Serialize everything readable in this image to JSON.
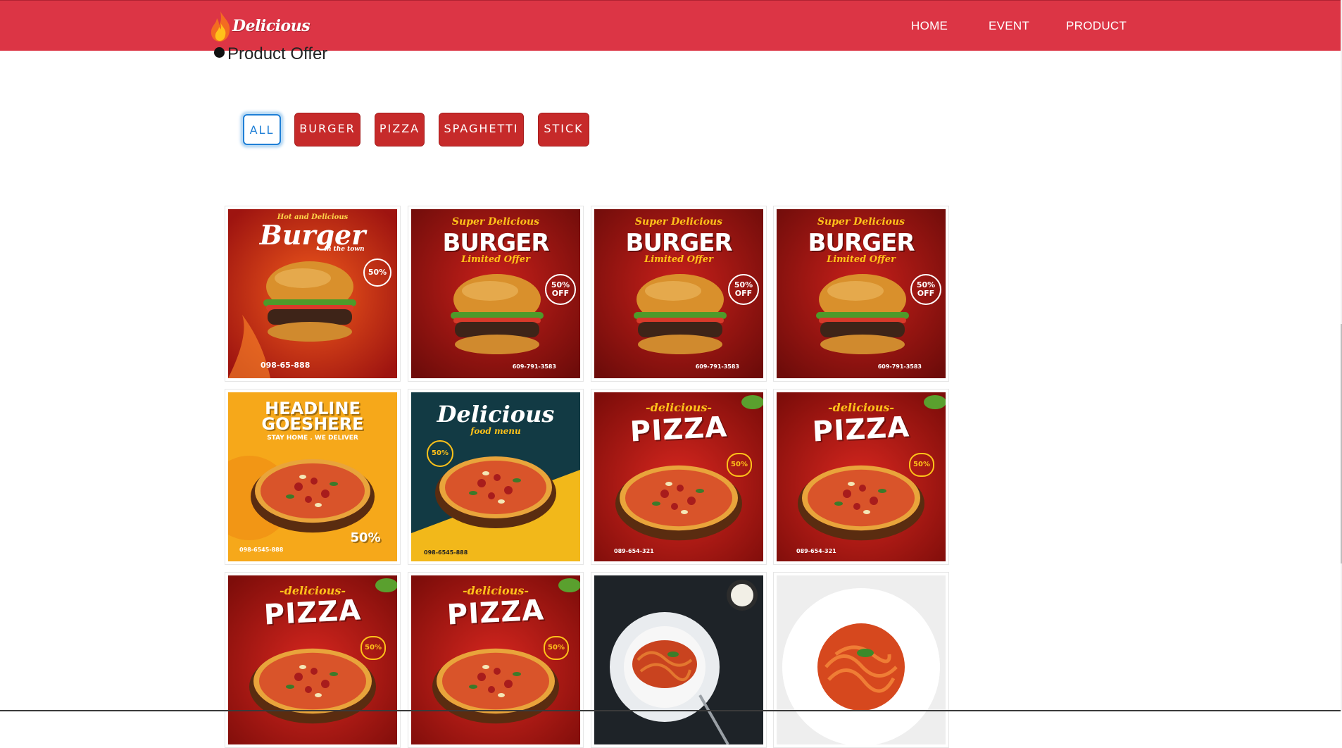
{
  "header": {
    "brand": "Delicious",
    "nav": [
      "HOME",
      "EVENT",
      "PRODUCT"
    ]
  },
  "section": {
    "title": "Product Offer"
  },
  "filters": [
    {
      "label": "ALL",
      "active": true
    },
    {
      "label": "BURGER",
      "active": false
    },
    {
      "label": "PIZZA",
      "active": false
    },
    {
      "label": "SPAGHETTI",
      "active": false
    },
    {
      "label": "STICK",
      "active": false
    }
  ],
  "products": [
    {
      "category": "burger",
      "style": "burger-a",
      "headline": "Burger",
      "kicker": "Hot and Delicious",
      "sub": "in the town",
      "badge": "50%",
      "phone": "098-65-888"
    },
    {
      "category": "burger",
      "style": "burger-b",
      "headline": "BURGER",
      "kicker": "Super Delicious",
      "sub": "Limited Offer",
      "badge": "50% OFF",
      "phone": "609-791-3583"
    },
    {
      "category": "burger",
      "style": "burger-b",
      "headline": "BURGER",
      "kicker": "Super Delicious",
      "sub": "Limited Offer",
      "badge": "50% OFF",
      "phone": "609-791-3583"
    },
    {
      "category": "burger",
      "style": "burger-b",
      "headline": "BURGER",
      "kicker": "Super Delicious",
      "sub": "Limited Offer",
      "badge": "50% OFF",
      "phone": "609-791-3583"
    },
    {
      "category": "pizza",
      "style": "pizza-yellow",
      "headline": "HEADLINE GOESHERE",
      "sub": "STAY HOME . WE DELIVER",
      "badge": "50%",
      "phone": "098-6545-888"
    },
    {
      "category": "pizza",
      "style": "pizza-dark",
      "headline": "Delicious",
      "kicker": "food menu",
      "badge": "50%",
      "phone": "098-6545-888"
    },
    {
      "category": "pizza",
      "style": "pizza-red",
      "headline": "PIZZA",
      "kicker": "-delicious-",
      "badge": "50%",
      "phone": "089-654-321"
    },
    {
      "category": "pizza",
      "style": "pizza-red",
      "headline": "PIZZA",
      "kicker": "-delicious-",
      "badge": "50%",
      "phone": "089-654-321"
    },
    {
      "category": "pizza",
      "style": "pizza-red",
      "headline": "PIZZA",
      "kicker": "-delicious-",
      "badge": "50%",
      "phone": ""
    },
    {
      "category": "pizza",
      "style": "pizza-red",
      "headline": "PIZZA",
      "kicker": "-delicious-",
      "badge": "50%",
      "phone": ""
    },
    {
      "category": "spaghetti",
      "style": "spaghetti-dark",
      "headline": "",
      "phone": ""
    },
    {
      "category": "spaghetti",
      "style": "spaghetti-light",
      "headline": "",
      "phone": ""
    }
  ],
  "colors": {
    "navbar": "#dc3545",
    "filter_button": "#c62a2a",
    "filter_active_border": "#1f7fd6"
  }
}
